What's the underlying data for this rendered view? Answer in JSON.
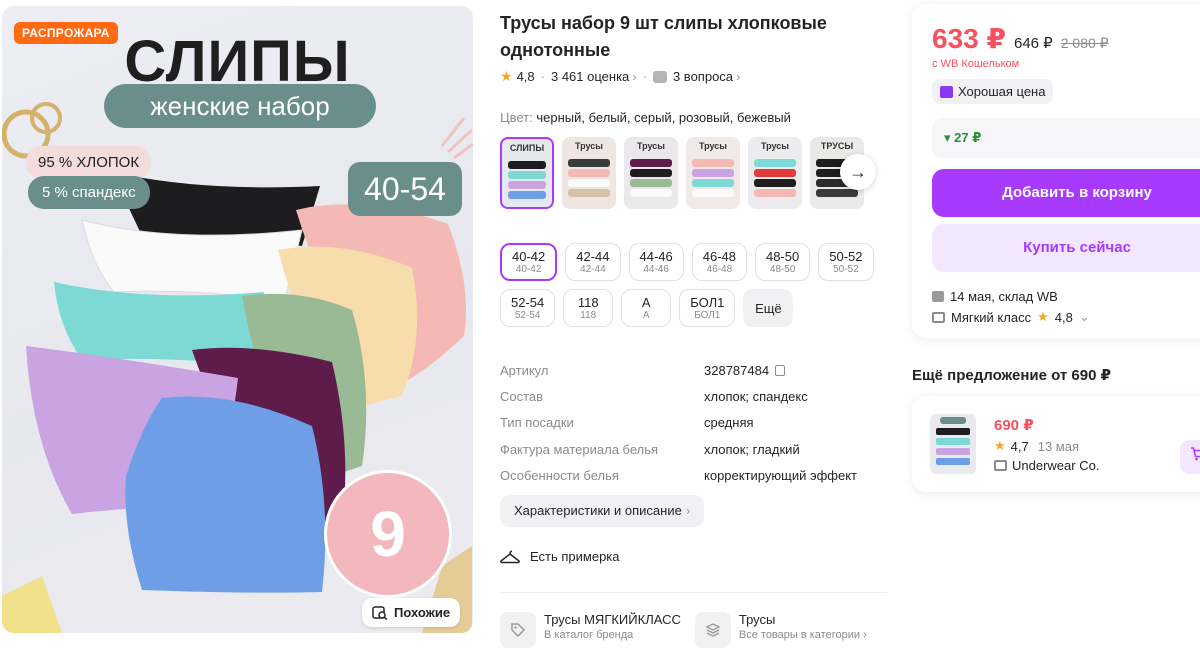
{
  "photo": {
    "sale_badge": "РАСПРОЖАРА",
    "headline": "СЛИПЫ",
    "subheadline": "женские набор",
    "cotton": "95 % ХЛОПОК",
    "spandex": "5 % спандекс",
    "size_range": "40-54",
    "seal_number": "9",
    "similar_label": "Похожие"
  },
  "product": {
    "title": "Трусы набор 9 шт слипы хлопковые однотонные",
    "rating": "4,8",
    "reviews": "3 461 оценка",
    "questions": "3 вопроса",
    "color_label": "Цвет:",
    "color_value": "черный, белый, серый, розовый, бежевый"
  },
  "swatches": [
    {
      "label": "СЛИПЫ",
      "selected": true
    },
    {
      "label": "Трусы",
      "selected": false
    },
    {
      "label": "Трусы",
      "selected": false
    },
    {
      "label": "Трусы",
      "selected": false
    },
    {
      "label": "Трусы",
      "selected": false
    },
    {
      "label": "ТРУСЫ",
      "selected": false
    }
  ],
  "sizes": [
    {
      "a": "40-42",
      "b": "40-42",
      "selected": true
    },
    {
      "a": "42-44",
      "b": "42-44",
      "selected": false
    },
    {
      "a": "44-46",
      "b": "44-46",
      "selected": false
    },
    {
      "a": "46-48",
      "b": "46-48",
      "selected": false
    },
    {
      "a": "48-50",
      "b": "48-50",
      "selected": false
    },
    {
      "a": "50-52",
      "b": "50-52",
      "selected": false
    },
    {
      "a": "52-54",
      "b": "52-54",
      "selected": false
    },
    {
      "a": "118",
      "b": "118",
      "selected": false
    },
    {
      "a": "А",
      "b": "А",
      "selected": false
    },
    {
      "a": "БОЛ1",
      "b": "БОЛ1",
      "selected": false
    }
  ],
  "sizes_more": "Ещё",
  "specs": [
    {
      "k": "Артикул",
      "v": "328787484"
    },
    {
      "k": "Состав",
      "v": "хлопок; спандекс"
    },
    {
      "k": "Тип посадки",
      "v": "средняя"
    },
    {
      "k": "Фактура материала белья",
      "v": "хлопок; гладкий"
    },
    {
      "k": "Особенности белья",
      "v": "корректирующий эффект"
    }
  ],
  "characteristics_button": "Характеристики и описание",
  "fitting": "Есть примерка",
  "brand": {
    "title": "Трусы МЯГКИЙКЛАСС",
    "sub": "В каталог бренда"
  },
  "category": {
    "title": "Трусы",
    "sub": "Все товары в категории"
  },
  "buy": {
    "price": "633 ₽",
    "price_b": "646 ₽",
    "price_old": "2 080 ₽",
    "wallet": "с WB Кошельком",
    "good_price": "Хорошая цена",
    "cashback": "27 ₽",
    "add_to_cart": "Добавить в корзину",
    "buy_now": "Купить сейчас",
    "delivery": "14 мая, склад WB",
    "seller": "Мягкий класс",
    "seller_rating": "4,8"
  },
  "more_offer": {
    "title": "Ещё предложение от 690 ₽",
    "price": "690 ₽",
    "rating": "4,7",
    "date": "13 мая",
    "seller": "Underwear Co."
  },
  "colors": {
    "accent": "#a73afd",
    "price": "#f5515f",
    "badge": "#ff6a13",
    "teal": "#6a8e8b"
  }
}
